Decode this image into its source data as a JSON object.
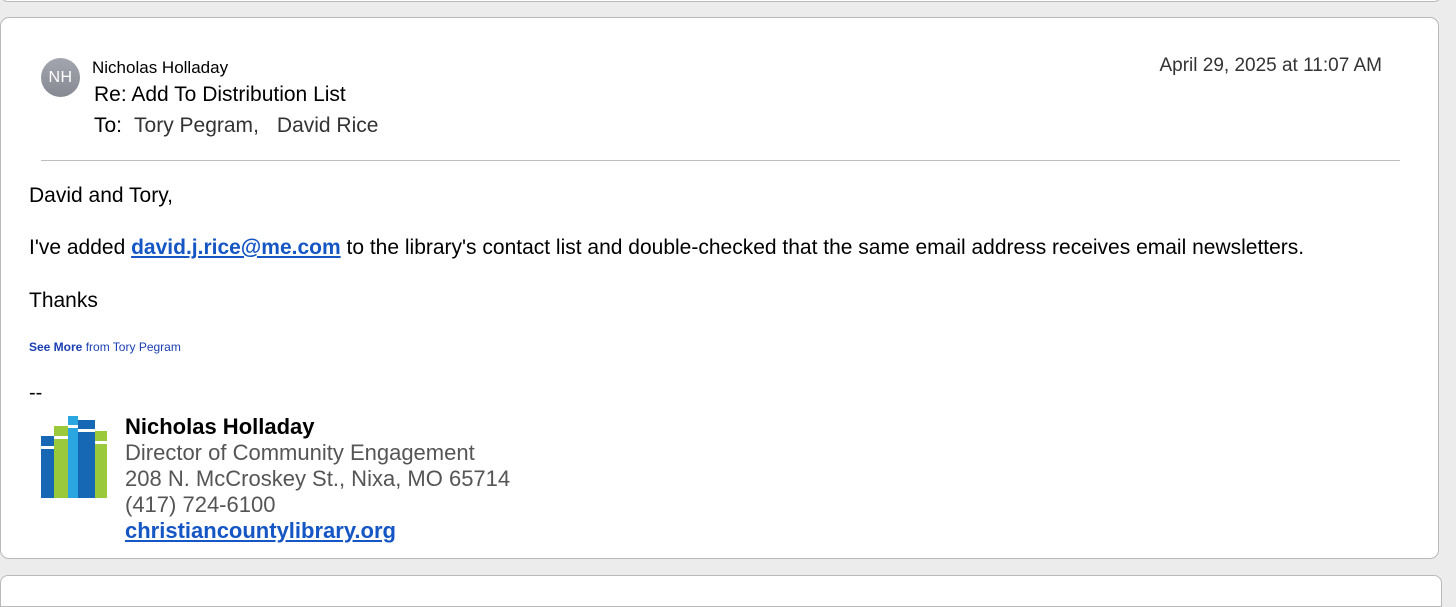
{
  "message": {
    "avatar_initials": "NH",
    "sender": "Nicholas Holladay",
    "date": "April 29, 2025 at 11:07 AM",
    "subject": "Re: Add To Distribution List",
    "to_label": "To:",
    "recipients": [
      "Tory Pegram",
      "David Rice"
    ],
    "recipient_separator": ","
  },
  "body": {
    "greeting": "David and Tory,",
    "line_prefix": "I've added ",
    "email_link": "david.j.rice@me.com",
    "line_suffix": " to the library's contact list and double-checked that the same email address receives email newsletters.",
    "closing": "Thanks",
    "see_more_bold": "See More",
    "see_more_rest": " from Tory Pegram",
    "sig_dashes": "--"
  },
  "signature": {
    "name": "Nicholas Holladay",
    "title": "Director of Community Engagement",
    "address": "208 N. McCroskey St., Nixa, MO 65714",
    "phone": "(417) 724-6100",
    "website": "christiancountylibrary.org",
    "logo_icon": "library-books-logo"
  },
  "colors": {
    "link": "#1556c5",
    "see_more": "#1a3fb3",
    "logo_blue": "#1667b4",
    "logo_green": "#9bc93c",
    "logo_cyan": "#2aa7e0"
  }
}
